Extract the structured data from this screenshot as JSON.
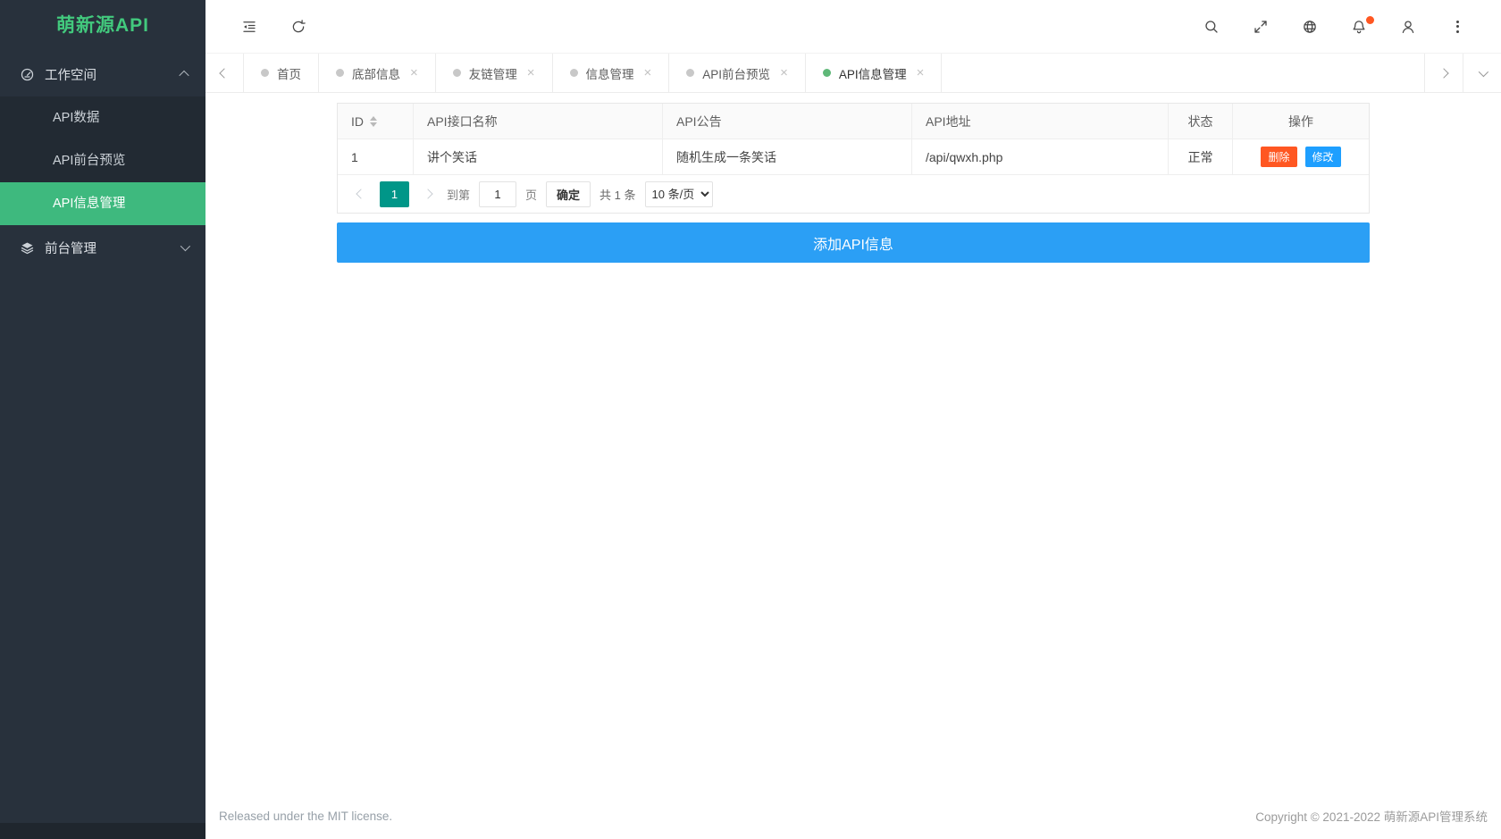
{
  "app": {
    "logo": "萌新源API"
  },
  "sidebar": {
    "sections": [
      {
        "label": "工作空间",
        "icon": "dashboard-icon",
        "expanded": true,
        "children": [
          {
            "label": "API数据",
            "active": false
          },
          {
            "label": "API前台预览",
            "active": false
          },
          {
            "label": "API信息管理",
            "active": true
          }
        ]
      },
      {
        "label": "前台管理",
        "icon": "layers-icon",
        "expanded": false,
        "children": []
      }
    ]
  },
  "topbar": {
    "left_icons": [
      "collapse-sidebar-icon",
      "refresh-icon"
    ],
    "right_icons": [
      "search-icon",
      "fullscreen-icon",
      "globe-icon",
      "bell-icon",
      "user-icon",
      "more-icon"
    ],
    "bell_has_badge": true
  },
  "tabs": {
    "close_glyph": "×",
    "items": [
      {
        "label": "首页",
        "active": false,
        "closable": false
      },
      {
        "label": "底部信息",
        "active": false,
        "closable": true
      },
      {
        "label": "友链管理",
        "active": false,
        "closable": true
      },
      {
        "label": "信息管理",
        "active": false,
        "closable": true
      },
      {
        "label": "API前台预览",
        "active": false,
        "closable": true
      },
      {
        "label": "API信息管理",
        "active": true,
        "closable": true
      }
    ]
  },
  "table": {
    "columns": [
      "ID",
      "API接口名称",
      "API公告",
      "API地址",
      "状态",
      "操作"
    ],
    "rows": [
      {
        "id": "1",
        "name": "讲个笑话",
        "notice": "随机生成一条笑话",
        "address": "/api/qwxh.php",
        "status": "正常"
      }
    ],
    "actions": {
      "delete": "删除",
      "edit": "修改"
    }
  },
  "pagination": {
    "current": "1",
    "goto_label": "到第",
    "goto_value": "1",
    "unit_label": "页",
    "confirm_label": "确定",
    "total_label": "共 1 条",
    "page_size_option": "10 条/页"
  },
  "add_button": {
    "label": "添加API信息"
  },
  "footer": {
    "left": "Released under the MIT license.",
    "right": "Copyright © 2021-2022 萌新源API管理系统"
  },
  "colors": {
    "sidebar_bg": "#28313c",
    "submenu_bg": "#222a33",
    "logo_green": "#42c97d",
    "active_item_green": "#3eb97e",
    "tab_active_dot_green": "#5fb878",
    "primary_blue": "#1e9fff",
    "add_button_blue": "#2b9ff5",
    "danger_orange": "#ff5722",
    "pagination_teal": "#009688",
    "notification_badge": "#ff5722"
  }
}
